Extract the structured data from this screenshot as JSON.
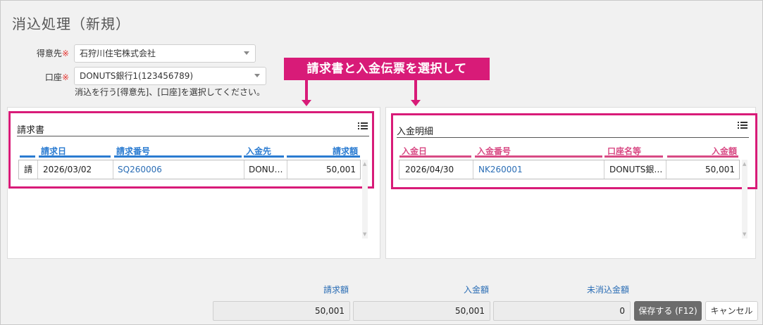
{
  "page": {
    "title": "消込処理（新規）"
  },
  "form": {
    "customer": {
      "label": "得意先",
      "required_mark": "※",
      "value": "石狩川住宅株式会社"
    },
    "account": {
      "label": "口座",
      "required_mark": "※",
      "value": "DONUTS銀行1(123456789)"
    },
    "hint": "消込を行う[得意先]、[口座]を選択してください。"
  },
  "annotation": {
    "banner": "請求書と入金伝票を選択して",
    "accent_color": "#d81b78"
  },
  "invoice_panel": {
    "title": "請求書",
    "menu_icon": "list-icon",
    "columns": [
      "請求日",
      "請求番号",
      "入金先",
      "請求額"
    ],
    "header_color": "#2a7bd1",
    "rows": [
      {
        "marker": "請",
        "date": "2026/03/02",
        "number": "SQ260006",
        "payee": "DONU…",
        "amount": "50,001"
      }
    ]
  },
  "payment_panel": {
    "title": "入金明細",
    "menu_icon": "list-icon",
    "columns": [
      "入金日",
      "入金番号",
      "口座名等",
      "入金額"
    ],
    "header_color": "#d84a84",
    "rows": [
      {
        "date": "2026/04/30",
        "number": "NK260001",
        "account": "DONUTS銀…",
        "amount": "50,001"
      }
    ]
  },
  "summary": {
    "invoice_label": "請求額",
    "invoice_value": "50,001",
    "payment_label": "入金額",
    "payment_value": "50,001",
    "remaining_label": "未消込金額",
    "remaining_value": "0"
  },
  "buttons": {
    "save": "保存する (F12)",
    "cancel": "キャンセル"
  }
}
